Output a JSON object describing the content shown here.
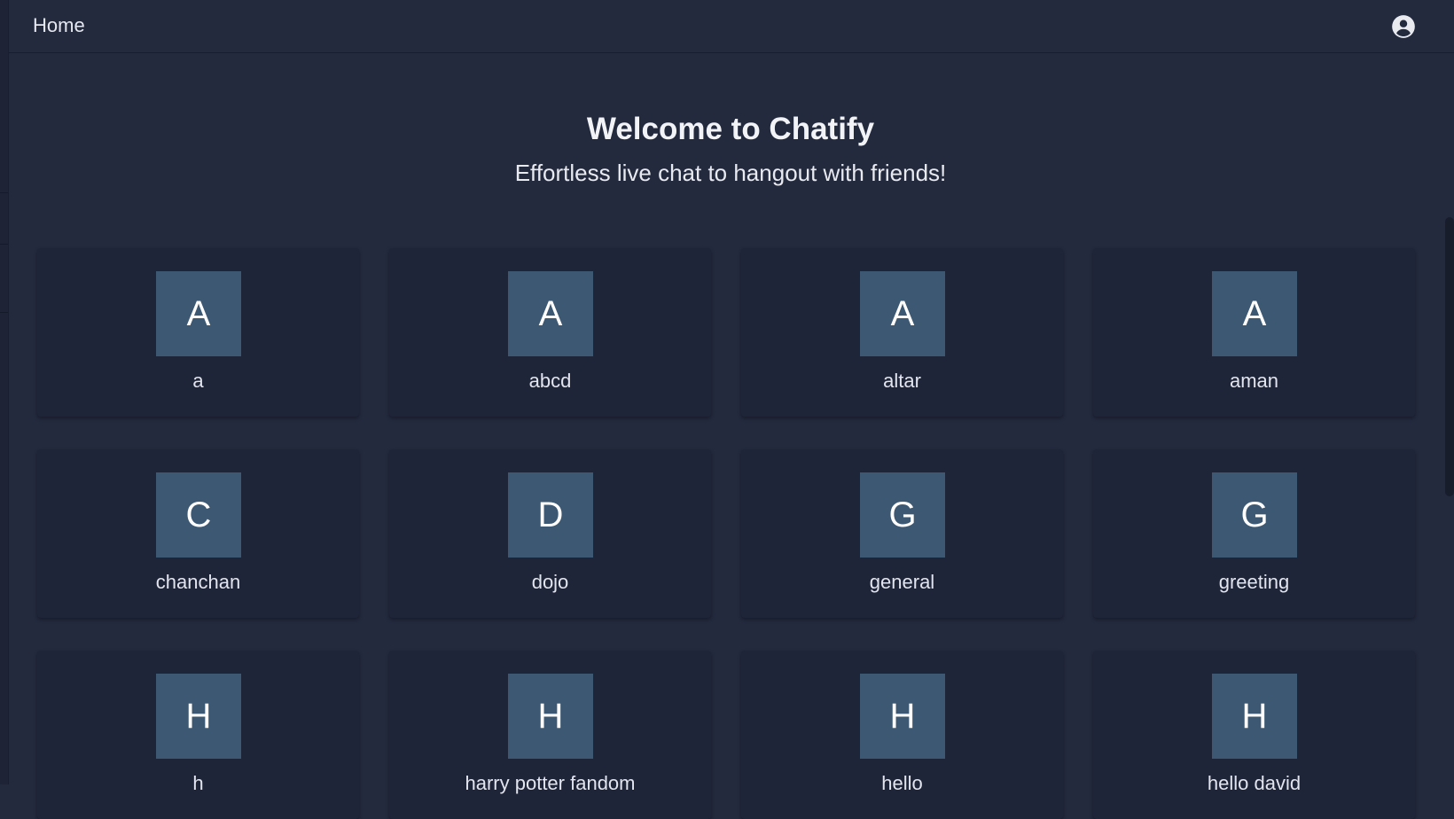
{
  "topbar": {
    "home_label": "Home",
    "account_icon": "account-circle-icon"
  },
  "hero": {
    "title": "Welcome to Chatify",
    "subtitle": "Effortless live chat to hangout with friends!"
  },
  "rooms": [
    {
      "initial": "A",
      "name": "a"
    },
    {
      "initial": "A",
      "name": "abcd"
    },
    {
      "initial": "A",
      "name": "altar"
    },
    {
      "initial": "A",
      "name": "aman"
    },
    {
      "initial": "C",
      "name": "chanchan"
    },
    {
      "initial": "D",
      "name": "dojo"
    },
    {
      "initial": "G",
      "name": "general"
    },
    {
      "initial": "G",
      "name": "greeting"
    },
    {
      "initial": "H",
      "name": "h"
    },
    {
      "initial": "H",
      "name": "harry potter fandom"
    },
    {
      "initial": "H",
      "name": "hello"
    },
    {
      "initial": "H",
      "name": "hello david"
    }
  ],
  "colors": {
    "background": "#232a3e",
    "card": "#1f2538",
    "avatar": "#3d5873"
  }
}
